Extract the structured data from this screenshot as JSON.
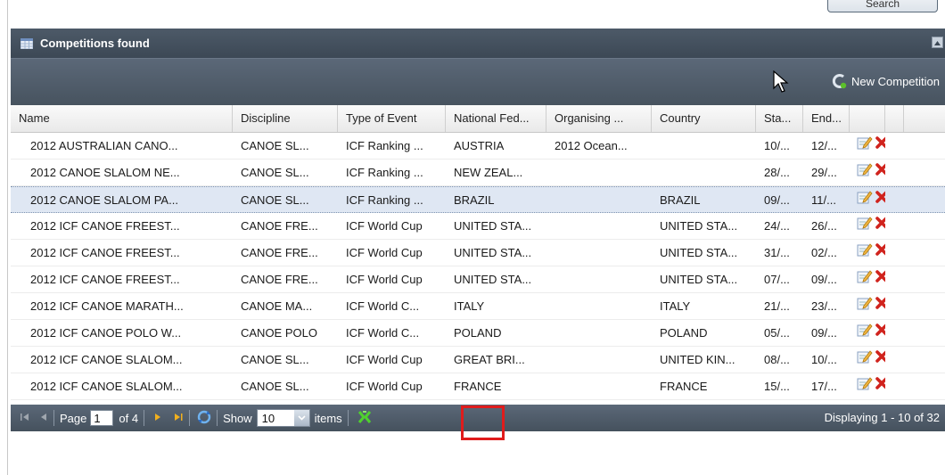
{
  "search_button": {
    "label": "Search"
  },
  "panel": {
    "title": "Competitions found",
    "toolbar": {
      "new_competition_label": "New Competition"
    }
  },
  "grid": {
    "columns": [
      "Name",
      "Discipline",
      "Type of Event",
      "National Fed...",
      "Organising ...",
      "Country",
      "Sta...",
      "End..."
    ],
    "rows": [
      {
        "name": "2012 AUSTRALIAN CANO...",
        "discipline": "CANOE SL...",
        "type": "ICF Ranking ...",
        "fed": "AUSTRIA",
        "org": "2012 Ocean...",
        "country": "",
        "start": "10/...",
        "end": "12/...",
        "selected": false
      },
      {
        "name": "2012 CANOE SLALOM NE...",
        "discipline": "CANOE SL...",
        "type": "ICF Ranking ...",
        "fed": "NEW ZEAL...",
        "org": "",
        "country": "",
        "start": "28/...",
        "end": "29/...",
        "selected": false
      },
      {
        "name": "2012 CANOE SLALOM PA...",
        "discipline": "CANOE SL...",
        "type": "ICF Ranking ...",
        "fed": "BRAZIL",
        "org": "",
        "country": "BRAZIL",
        "start": "09/...",
        "end": "11/...",
        "selected": true
      },
      {
        "name": "2012 ICF CANOE FREEST...",
        "discipline": "CANOE FRE...",
        "type": "ICF World Cup",
        "fed": "UNITED STA...",
        "org": "",
        "country": "UNITED STA...",
        "start": "24/...",
        "end": "26/...",
        "selected": false
      },
      {
        "name": "2012 ICF CANOE FREEST...",
        "discipline": "CANOE FRE...",
        "type": "ICF World Cup",
        "fed": "UNITED STA...",
        "org": "",
        "country": "UNITED STA...",
        "start": "31/...",
        "end": "02/...",
        "selected": false
      },
      {
        "name": "2012 ICF CANOE FREEST...",
        "discipline": "CANOE FRE...",
        "type": "ICF World Cup",
        "fed": "UNITED STA...",
        "org": "",
        "country": "UNITED STA...",
        "start": "07/...",
        "end": "09/...",
        "selected": false
      },
      {
        "name": "2012 ICF CANOE MARATH...",
        "discipline": "CANOE MA...",
        "type": "ICF World C...",
        "fed": "ITALY",
        "org": "",
        "country": "ITALY",
        "start": "21/...",
        "end": "23/...",
        "selected": false
      },
      {
        "name": "2012 ICF CANOE POLO W...",
        "discipline": "CANOE POLO",
        "type": "ICF World C...",
        "fed": "POLAND",
        "org": "",
        "country": "POLAND",
        "start": "05/...",
        "end": "09/...",
        "selected": false
      },
      {
        "name": "2012 ICF CANOE SLALOM...",
        "discipline": "CANOE SL...",
        "type": "ICF World Cup",
        "fed": "GREAT BRI...",
        "org": "",
        "country": "UNITED KIN...",
        "start": "08/...",
        "end": "10/...",
        "selected": false
      },
      {
        "name": "2012 ICF CANOE SLALOM...",
        "discipline": "CANOE SL...",
        "type": "ICF World Cup",
        "fed": "FRANCE",
        "org": "",
        "country": "FRANCE",
        "start": "15/...",
        "end": "17/...",
        "selected": false
      }
    ],
    "row_icons": {
      "edit": "edit-icon",
      "delete": "delete-icon"
    }
  },
  "paging": {
    "page_label": "Page",
    "page_value": "1",
    "of_label": "of 4",
    "show_label": "Show",
    "show_value": "10",
    "items_label": "items",
    "displaying": "Displaying 1 - 10 of 32"
  },
  "colors": {
    "header_dark": "#3c4855",
    "selected_row": "#dfe7f3",
    "highlight": "#e01c1c",
    "delete_red": "#d0231d"
  }
}
